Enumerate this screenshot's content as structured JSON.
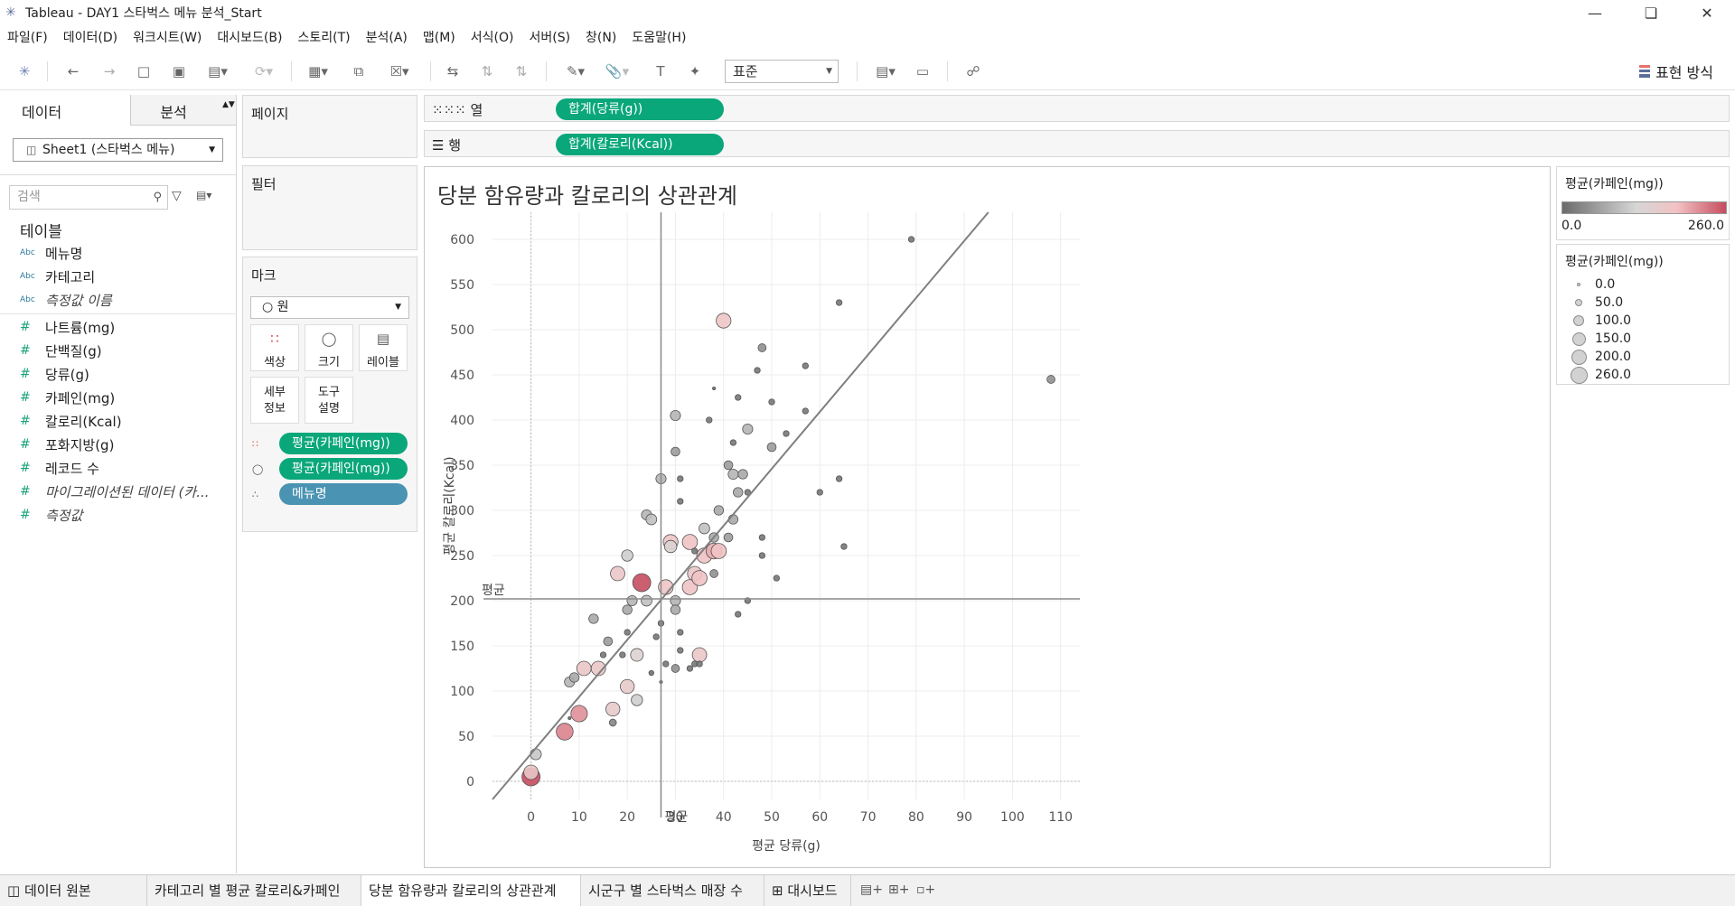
{
  "window": {
    "title": "Tableau - DAY1 스타벅스 메뉴 분석_Start"
  },
  "menu": [
    "파일(F)",
    "데이터(D)",
    "워크시트(W)",
    "대시보드(B)",
    "스토리(T)",
    "분석(A)",
    "맵(M)",
    "서식(O)",
    "서버(S)",
    "창(N)",
    "도움말(H)"
  ],
  "toolbar": {
    "fit_select": "표준",
    "show_me": "표현 방식"
  },
  "data_pane": {
    "tab_data": "데이터",
    "tab_analytics": "분석",
    "datasource": "Sheet1 (스타벅스 메뉴)",
    "search_placeholder": "검색",
    "tables_header": "테이블",
    "type_abc": "Abc",
    "type_num": "#",
    "dimensions": [
      "메뉴명",
      "카테고리",
      "측정값 이름"
    ],
    "measures": [
      "나트륨(mg)",
      "단백질(g)",
      "당류(g)",
      "카페인(mg)",
      "칼로리(Kcal)",
      "포화지방(g)",
      "레코드 수",
      "마이그레이션된 데이터 (카...",
      "측정값"
    ]
  },
  "cards": {
    "pages": "페이지",
    "filters": "필터",
    "marks": "마크",
    "mark_type": "원",
    "buttons": {
      "color": "색상",
      "size": "크기",
      "label": "레이블",
      "detail": "세부\n정보",
      "tooltip": "도구\n설명"
    },
    "pills": [
      "평균(카페인(mg))",
      "평균(카페인(mg))",
      "메뉴명"
    ]
  },
  "shelves": {
    "columns_label": "열",
    "rows_label": "행",
    "columns_pill": "합계(당류(g))",
    "rows_pill": "합계(칼로리(Kcal))"
  },
  "view": {
    "title": "당분 함유량과 칼로리의 상관관계"
  },
  "legends": {
    "color_title": "평균(카페인(mg))",
    "color_min": "0.0",
    "color_max": "260.0",
    "size_title": "평균(카페인(mg))",
    "size_items": [
      "0.0",
      "50.0",
      "100.0",
      "150.0",
      "200.0",
      "260.0"
    ]
  },
  "bottom_tabs": [
    "데이터 원본",
    "카테고리 별 평균 칼로리&카페인",
    "당분 함유량과 칼로리의 상관관계",
    "시군구 별 스타벅스 매장 수",
    "대시보드"
  ],
  "chart_data": {
    "type": "scatter",
    "title": "당분 함유량과 칼로리의 상관관계",
    "xlabel": "평균 당류(g)",
    "ylabel": "평균 칼로리(Kcal)",
    "xlim": [
      -8,
      114
    ],
    "ylim": [
      -20,
      630
    ],
    "x_ticks": [
      0,
      10,
      20,
      30,
      40,
      50,
      60,
      70,
      80,
      90,
      100,
      110
    ],
    "y_ticks": [
      0,
      50,
      100,
      150,
      200,
      250,
      300,
      350,
      400,
      450,
      500,
      550,
      600
    ],
    "reference_lines": {
      "x_average": 27,
      "y_average": 202,
      "label": "평균"
    },
    "trend_line": {
      "from": [
        -8,
        -20
      ],
      "to": [
        95,
        630
      ]
    },
    "color_scale": [
      "#6b6b6b",
      "#d6d6d6",
      "#f2c2c3",
      "#c54d5f"
    ],
    "size_field": "평균(카페인(mg))",
    "points": [
      {
        "x": 0,
        "y": 5,
        "c": 260
      },
      {
        "x": 0,
        "y": 10,
        "c": 150
      },
      {
        "x": 1,
        "y": 30,
        "c": 75
      },
      {
        "x": 7,
        "y": 55,
        "c": 220
      },
      {
        "x": 10,
        "y": 75,
        "c": 210
      },
      {
        "x": 8,
        "y": 70,
        "c": 0
      },
      {
        "x": 11,
        "y": 125,
        "c": 150
      },
      {
        "x": 14,
        "y": 125,
        "c": 150
      },
      {
        "x": 8,
        "y": 110,
        "c": 60
      },
      {
        "x": 9,
        "y": 115,
        "c": 50
      },
      {
        "x": 17,
        "y": 80,
        "c": 140
      },
      {
        "x": 17,
        "y": 65,
        "c": 20
      },
      {
        "x": 13,
        "y": 180,
        "c": 50
      },
      {
        "x": 16,
        "y": 155,
        "c": 40
      },
      {
        "x": 20,
        "y": 105,
        "c": 140
      },
      {
        "x": 22,
        "y": 90,
        "c": 80
      },
      {
        "x": 22,
        "y": 140,
        "c": 110
      },
      {
        "x": 25,
        "y": 120,
        "c": 5
      },
      {
        "x": 27,
        "y": 110,
        "c": 0
      },
      {
        "x": 30,
        "y": 125,
        "c": 30
      },
      {
        "x": 30,
        "y": 200,
        "c": 60
      },
      {
        "x": 30,
        "y": 190,
        "c": 50
      },
      {
        "x": 35,
        "y": 140,
        "c": 150
      },
      {
        "x": 18,
        "y": 230,
        "c": 150
      },
      {
        "x": 23,
        "y": 220,
        "c": 260
      },
      {
        "x": 28,
        "y": 215,
        "c": 160
      },
      {
        "x": 20,
        "y": 190,
        "c": 50
      },
      {
        "x": 21,
        "y": 200,
        "c": 60
      },
      {
        "x": 24,
        "y": 200,
        "c": 70
      },
      {
        "x": 20,
        "y": 250,
        "c": 80
      },
      {
        "x": 24,
        "y": 295,
        "c": 60
      },
      {
        "x": 25,
        "y": 290,
        "c": 70
      },
      {
        "x": 27,
        "y": 335,
        "c": 60
      },
      {
        "x": 29,
        "y": 265,
        "c": 160
      },
      {
        "x": 29,
        "y": 260,
        "c": 100
      },
      {
        "x": 30,
        "y": 405,
        "c": 60
      },
      {
        "x": 30,
        "y": 365,
        "c": 40
      },
      {
        "x": 33,
        "y": 265,
        "c": 170
      },
      {
        "x": 33,
        "y": 215,
        "c": 170
      },
      {
        "x": 34,
        "y": 230,
        "c": 150
      },
      {
        "x": 35,
        "y": 225,
        "c": 170
      },
      {
        "x": 36,
        "y": 250,
        "c": 170
      },
      {
        "x": 36,
        "y": 280,
        "c": 70
      },
      {
        "x": 38,
        "y": 255,
        "c": 190
      },
      {
        "x": 38,
        "y": 270,
        "c": 50
      },
      {
        "x": 38,
        "y": 230,
        "c": 30
      },
      {
        "x": 39,
        "y": 300,
        "c": 50
      },
      {
        "x": 39,
        "y": 255,
        "c": 170
      },
      {
        "x": 40,
        "y": 510,
        "c": 160
      },
      {
        "x": 41,
        "y": 270,
        "c": 40
      },
      {
        "x": 41,
        "y": 350,
        "c": 40
      },
      {
        "x": 42,
        "y": 340,
        "c": 60
      },
      {
        "x": 42,
        "y": 290,
        "c": 50
      },
      {
        "x": 43,
        "y": 320,
        "c": 50
      },
      {
        "x": 44,
        "y": 340,
        "c": 50
      },
      {
        "x": 45,
        "y": 390,
        "c": 60
      },
      {
        "x": 45,
        "y": 320,
        "c": 10
      },
      {
        "x": 47,
        "y": 455,
        "c": 10
      },
      {
        "x": 48,
        "y": 480,
        "c": 30
      },
      {
        "x": 50,
        "y": 370,
        "c": 40
      },
      {
        "x": 38,
        "y": 435,
        "c": 0
      },
      {
        "x": 37,
        "y": 400,
        "c": 10
      },
      {
        "x": 42,
        "y": 375,
        "c": 10
      },
      {
        "x": 43,
        "y": 425,
        "c": 10
      },
      {
        "x": 50,
        "y": 420,
        "c": 10
      },
      {
        "x": 53,
        "y": 385,
        "c": 10
      },
      {
        "x": 57,
        "y": 460,
        "c": 10
      },
      {
        "x": 57,
        "y": 410,
        "c": 10
      },
      {
        "x": 60,
        "y": 320,
        "c": 10
      },
      {
        "x": 64,
        "y": 530,
        "c": 10
      },
      {
        "x": 64,
        "y": 335,
        "c": 10
      },
      {
        "x": 65,
        "y": 260,
        "c": 10
      },
      {
        "x": 79,
        "y": 600,
        "c": 10
      },
      {
        "x": 108,
        "y": 445,
        "c": 30
      },
      {
        "x": 51,
        "y": 225,
        "c": 10
      },
      {
        "x": 48,
        "y": 250,
        "c": 10
      },
      {
        "x": 45,
        "y": 200,
        "c": 10
      },
      {
        "x": 43,
        "y": 185,
        "c": 10
      },
      {
        "x": 31,
        "y": 165,
        "c": 10
      },
      {
        "x": 33,
        "y": 125,
        "c": 10
      },
      {
        "x": 34,
        "y": 130,
        "c": 10
      },
      {
        "x": 19,
        "y": 140,
        "c": 10
      },
      {
        "x": 15,
        "y": 140,
        "c": 10
      },
      {
        "x": 20,
        "y": 165,
        "c": 10
      },
      {
        "x": 26,
        "y": 160,
        "c": 10
      },
      {
        "x": 31,
        "y": 145,
        "c": 10
      },
      {
        "x": 35,
        "y": 130,
        "c": 10
      },
      {
        "x": 28,
        "y": 130,
        "c": 10
      },
      {
        "x": 34,
        "y": 255,
        "c": 10
      },
      {
        "x": 31,
        "y": 310,
        "c": 10
      },
      {
        "x": 31,
        "y": 335,
        "c": 10
      },
      {
        "x": 27,
        "y": 175,
        "c": 10
      },
      {
        "x": 48,
        "y": 270,
        "c": 10
      }
    ]
  }
}
